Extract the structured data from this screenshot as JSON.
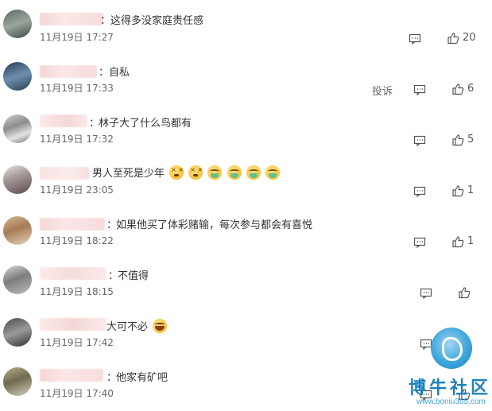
{
  "comments": [
    {
      "text": "这得多没家庭责任感",
      "time": "11月19日 17:27",
      "likes": "20",
      "colon": "：",
      "report": ""
    },
    {
      "text": "自私",
      "time": "11月19日 17:33",
      "likes": "6",
      "colon": "：",
      "report": "投诉"
    },
    {
      "text": "林子大了什么鸟都有",
      "time": "11月19日 17:32",
      "likes": "5",
      "colon": "：",
      "report": ""
    },
    {
      "text": "男人至死是少年",
      "time": "11月19日 23:05",
      "likes": "1",
      "colon": "",
      "report": ""
    },
    {
      "text": "如果他买了体彩赌输，每次参与都会有喜悦",
      "time": "11月19日 18:22",
      "likes": "1",
      "colon": "：",
      "report": ""
    },
    {
      "text": "不值得",
      "time": "11月19日 18:15",
      "likes": "",
      "colon": "：",
      "report": ""
    },
    {
      "text": "大可不必",
      "time": "11月19日 17:42",
      "likes": "",
      "colon": "",
      "report": ""
    },
    {
      "text": "他家有矿吧",
      "time": "11月19日 17:40",
      "likes": "",
      "colon": "：",
      "report": ""
    }
  ],
  "icons": {
    "reply": "reply-comment-icon",
    "like": "thumbs-up-icon"
  },
  "watermark": {
    "title": "博牛社区",
    "url": "www.boniu365.com"
  },
  "colors": {
    "text": "#333333",
    "time": "#666666",
    "name_mask": "#f7d6d6",
    "watermark": "#1d82c0"
  }
}
